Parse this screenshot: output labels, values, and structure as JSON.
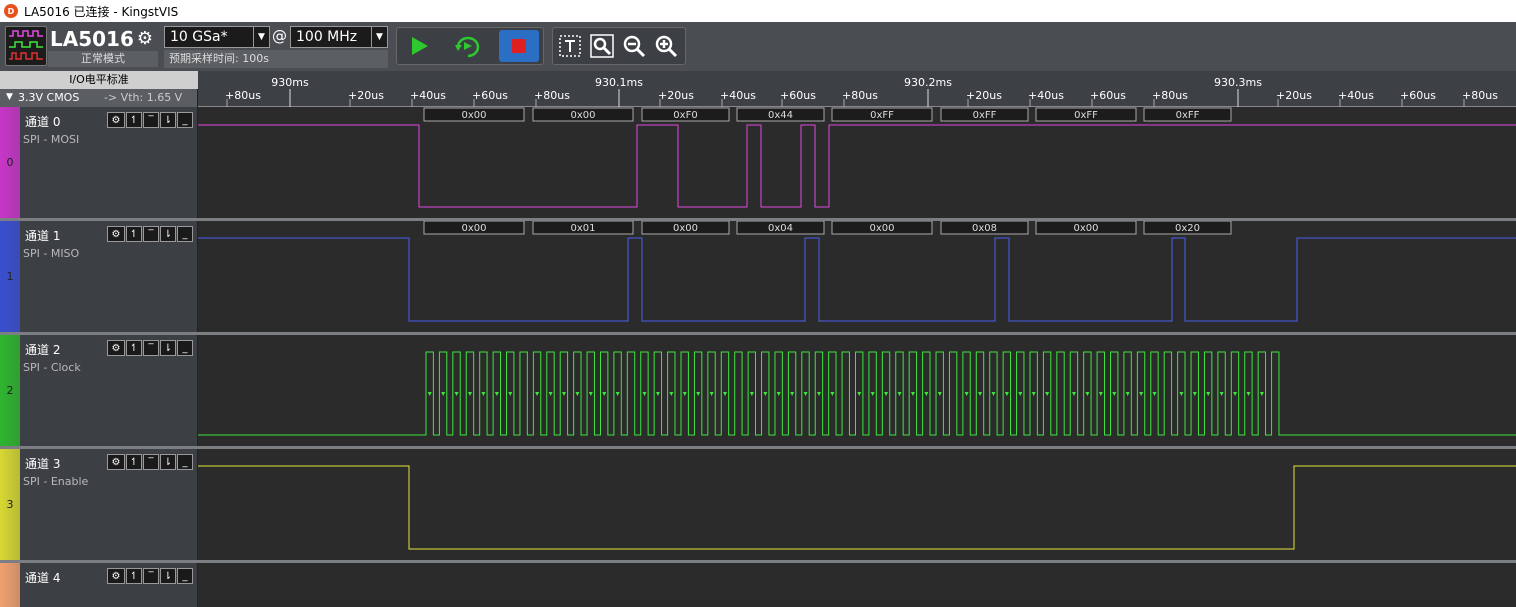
{
  "window": {
    "title": "LA5016 已连接 - KingstVIS",
    "logo_text": "D"
  },
  "device": {
    "name": "LA5016",
    "mode": "正常模式",
    "settings_icon": "gear-icon"
  },
  "sample_rate": {
    "value": "10 GSa*",
    "at": "@"
  },
  "frequency": {
    "value": "100 MHz"
  },
  "sample_time": {
    "label": "预期采样时间: 100s"
  },
  "io_panel": {
    "title": "I/O电平标准",
    "level": "3.3V CMOS",
    "vth": "-> Vth: 1.65 V"
  },
  "toolbar_icons": [
    "play-icon",
    "repeat-icon",
    "stop-icon",
    "text-cursor-icon",
    "zoom-fit-icon",
    "zoom-out-icon",
    "zoom-in-icon"
  ],
  "ruler": {
    "major_labels": [
      "930ms",
      "930.1ms",
      "930.2ms",
      "930.3ms"
    ],
    "minor_labels": [
      "+80us",
      "+20us",
      "+40us",
      "+60us",
      "+80us",
      "+20us",
      "+40us",
      "+60us",
      "+80us",
      "+20us",
      "+40us",
      "+60us",
      "+80us",
      "+20us",
      "+40us",
      "+60us",
      "+80us"
    ]
  },
  "channels": [
    {
      "name": "通道 0",
      "protocol": "SPI - MOSI",
      "index": "0",
      "color": "#c836c8",
      "wave_color": "#e04ae0",
      "decode": [
        "0x00",
        "0x00",
        "0xF0",
        "0x44",
        "0xFF",
        "0xFF",
        "0xFF",
        "0xFF"
      ]
    },
    {
      "name": "通道 1",
      "protocol": "SPI - MISO",
      "index": "1",
      "color": "#3a4fd0",
      "wave_color": "#4a5ff0",
      "decode": [
        "0x00",
        "0x01",
        "0x00",
        "0x04",
        "0x00",
        "0x08",
        "0x00",
        "0x20"
      ]
    },
    {
      "name": "通道 2",
      "protocol": "SPI - Clock",
      "index": "2",
      "color": "#2fb52f",
      "wave_color": "#3ee63e",
      "decode": []
    },
    {
      "name": "通道 3",
      "protocol": "SPI - Enable",
      "index": "3",
      "color": "#d8d832",
      "wave_color": "#e6e63a",
      "decode": []
    },
    {
      "name": "通道 4",
      "protocol": "",
      "index": "",
      "color": "#f0a070",
      "wave_color": "#f0a070",
      "decode": []
    }
  ],
  "channel_controls": {
    "gear": "⚙",
    "rise": "↿",
    "high": "‾",
    "fall": "⇂",
    "low": "_"
  },
  "colors": {
    "toolbar": "#4a4d52",
    "wave_bg": "#2b2b2b",
    "stop_button": "#2a6fc4"
  }
}
